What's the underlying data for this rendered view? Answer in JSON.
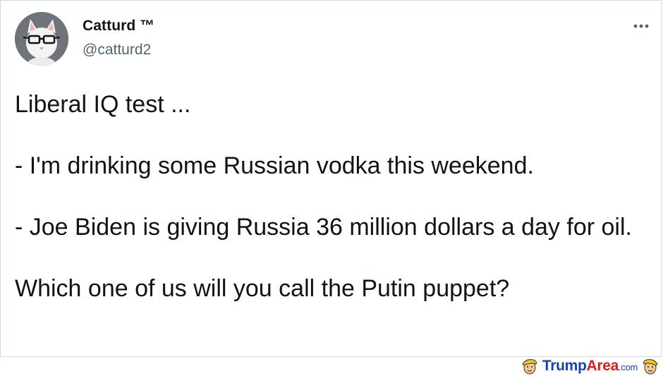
{
  "tweet": {
    "author_name": "Catturd ™",
    "author_handle": "@catturd2",
    "more_icon": "more-horizontal-icon",
    "text": "Liberal IQ test ...\n\n- I'm drinking some Russian vodka this weekend.\n\n- Joe Biden is giving Russia 36 million dollars a day for oil.\n\nWhich one of us will you call the Putin puppet?"
  },
  "watermark": {
    "name_part1": "Trump",
    "name_part2": "Area",
    "domain_suffix": ".com",
    "brand_blue": "#1b3fae",
    "brand_red": "#d42020"
  },
  "colors": {
    "text_primary": "#0f1419",
    "text_secondary": "#536471",
    "border": "#cfd9de"
  }
}
